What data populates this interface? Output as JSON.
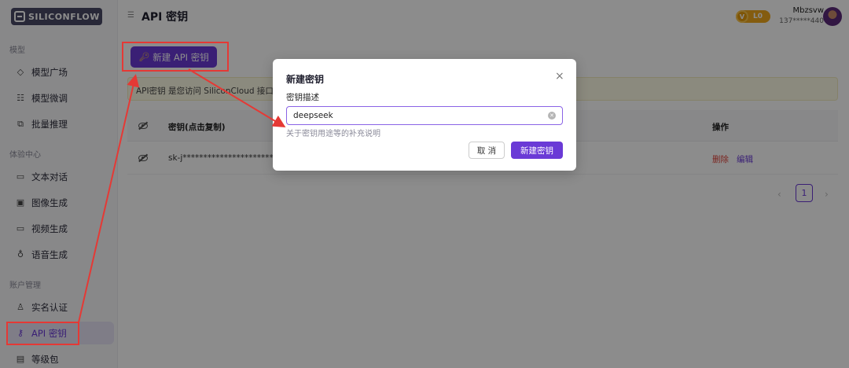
{
  "brand": {
    "logo_text": "SILICONFLOW"
  },
  "header": {
    "title": "API 密钥",
    "level": {
      "badge": "V",
      "label": "L0"
    },
    "user": {
      "name": "Mbzsvw",
      "phone": "137*****440"
    }
  },
  "sidebar": {
    "sections": [
      {
        "label": "模型",
        "items": [
          {
            "label": "模型广场",
            "icon": "cube-icon"
          },
          {
            "label": "模型微调",
            "icon": "sliders-icon"
          },
          {
            "label": "批量推理",
            "icon": "batch-icon"
          }
        ]
      },
      {
        "label": "体验中心",
        "items": [
          {
            "label": "文本对话",
            "icon": "chat-icon"
          },
          {
            "label": "图像生成",
            "icon": "image-icon"
          },
          {
            "label": "视频生成",
            "icon": "video-icon"
          },
          {
            "label": "语音生成",
            "icon": "mic-icon"
          }
        ]
      },
      {
        "label": "账户管理",
        "items": [
          {
            "label": "实名认证",
            "icon": "user-check-icon"
          },
          {
            "label": "API 密钥",
            "icon": "key-icon",
            "active": true
          },
          {
            "label": "等级包",
            "icon": "package-icon"
          }
        ]
      }
    ]
  },
  "main": {
    "new_key_button": "新建 API 密钥",
    "banner_text": "API密钥 是您访问 SiliconCloud 接口的",
    "table": {
      "columns": [
        "",
        "密钥(点击复制)",
        "操作"
      ],
      "rows": [
        {
          "key": "sk-j********************************",
          "actions": {
            "delete": "删除",
            "edit": "编辑"
          }
        }
      ]
    },
    "pagination": {
      "current": "1",
      "prev": "‹",
      "next": "›"
    }
  },
  "modal": {
    "title": "新建密钥",
    "close": "×",
    "field_label": "密钥描述",
    "field_value": "deepseek",
    "helper": "关于密钥用途等的补充说明",
    "cancel": "取 消",
    "submit": "新建密钥"
  },
  "colors": {
    "accent": "#6a3ad6",
    "danger": "#e0433a",
    "annotation": "#e53935",
    "level": "#f1a81d"
  }
}
